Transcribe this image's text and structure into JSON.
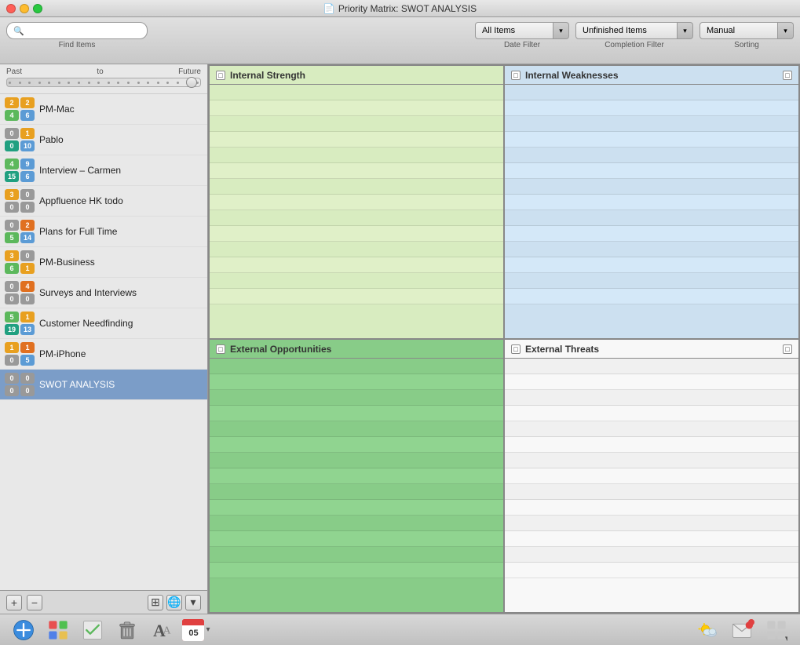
{
  "app": {
    "title": "Priority Matrix: SWOT ANALYSIS",
    "icon": "📄"
  },
  "toolbar": {
    "search_placeholder": "",
    "find_label": "Find Items",
    "date_filter_label": "Date Filter",
    "completion_filter_label": "Completion Filter",
    "sorting_label": "Sorting",
    "items_dropdown": "All Items",
    "unfinished_dropdown": "Unfinished Items",
    "manual_dropdown": "Manual"
  },
  "time_slider": {
    "past_label": "Past",
    "to_label": "to",
    "future_label": "Future"
  },
  "projects": [
    {
      "name": "PM-Mac",
      "badge1": "2",
      "badge1_color": "badge-yellow",
      "badge2": "2",
      "badge2_color": "badge-yellow",
      "badge3": "4",
      "badge3_color": "badge-green",
      "badge4": "6",
      "badge4_color": "badge-blue",
      "selected": false
    },
    {
      "name": "Pablo",
      "badge1": "0",
      "badge1_color": "badge-gray",
      "badge2": "1",
      "badge2_color": "badge-yellow",
      "badge3": "0",
      "badge3_color": "badge-teal",
      "badge4": "10",
      "badge4_color": "badge-blue",
      "selected": false
    },
    {
      "name": "Interview – Carmen",
      "badge1": "4",
      "badge1_color": "badge-green",
      "badge2": "9",
      "badge2_color": "badge-blue",
      "badge3": "15",
      "badge3_color": "badge-teal",
      "badge4": "6",
      "badge4_color": "badge-blue",
      "selected": false
    },
    {
      "name": "Appfluence HK todo",
      "badge1": "3",
      "badge1_color": "badge-yellow",
      "badge2": "0",
      "badge2_color": "badge-gray",
      "badge3": "0",
      "badge3_color": "badge-gray",
      "badge4": "0",
      "badge4_color": "badge-gray",
      "selected": false
    },
    {
      "name": "Plans for Full Time",
      "badge1": "0",
      "badge1_color": "badge-gray",
      "badge2": "2",
      "badge2_color": "badge-orange",
      "badge3": "5",
      "badge3_color": "badge-green",
      "badge4": "14",
      "badge4_color": "badge-blue",
      "selected": false
    },
    {
      "name": "PM-Business",
      "badge1": "3",
      "badge1_color": "badge-yellow",
      "badge2": "0",
      "badge2_color": "badge-gray",
      "badge3": "6",
      "badge3_color": "badge-green",
      "badge4": "1",
      "badge4_color": "badge-yellow",
      "selected": false
    },
    {
      "name": "Surveys and Interviews",
      "badge1": "0",
      "badge1_color": "badge-gray",
      "badge2": "4",
      "badge2_color": "badge-orange",
      "badge3": "0",
      "badge3_color": "badge-gray",
      "badge4": "0",
      "badge4_color": "badge-gray",
      "selected": false
    },
    {
      "name": "Customer Needfinding",
      "badge1": "5",
      "badge1_color": "badge-green",
      "badge2": "1",
      "badge2_color": "badge-yellow",
      "badge3": "19",
      "badge3_color": "badge-teal",
      "badge4": "13",
      "badge4_color": "badge-blue",
      "selected": false
    },
    {
      "name": "PM-iPhone",
      "badge1": "1",
      "badge1_color": "badge-yellow",
      "badge2": "1",
      "badge2_color": "badge-orange",
      "badge3": "0",
      "badge3_color": "badge-gray",
      "badge4": "5",
      "badge4_color": "badge-blue",
      "selected": false
    },
    {
      "name": "SWOT ANALYSIS",
      "badge1": "0",
      "badge1_color": "badge-gray",
      "badge2": "0",
      "badge2_color": "badge-gray",
      "badge3": "0",
      "badge3_color": "badge-gray",
      "badge4": "0",
      "badge4_color": "badge-gray",
      "selected": true
    }
  ],
  "matrix": {
    "q1_header": "Internal Strength",
    "q2_header": "Internal Weaknesses",
    "q3_header": "External Opportunities",
    "q4_header": "External Threats",
    "rows_per_quadrant": 14
  },
  "bottom_toolbar": {
    "add_label": "+",
    "calendar_day": "05",
    "arrow_label": "▾"
  }
}
